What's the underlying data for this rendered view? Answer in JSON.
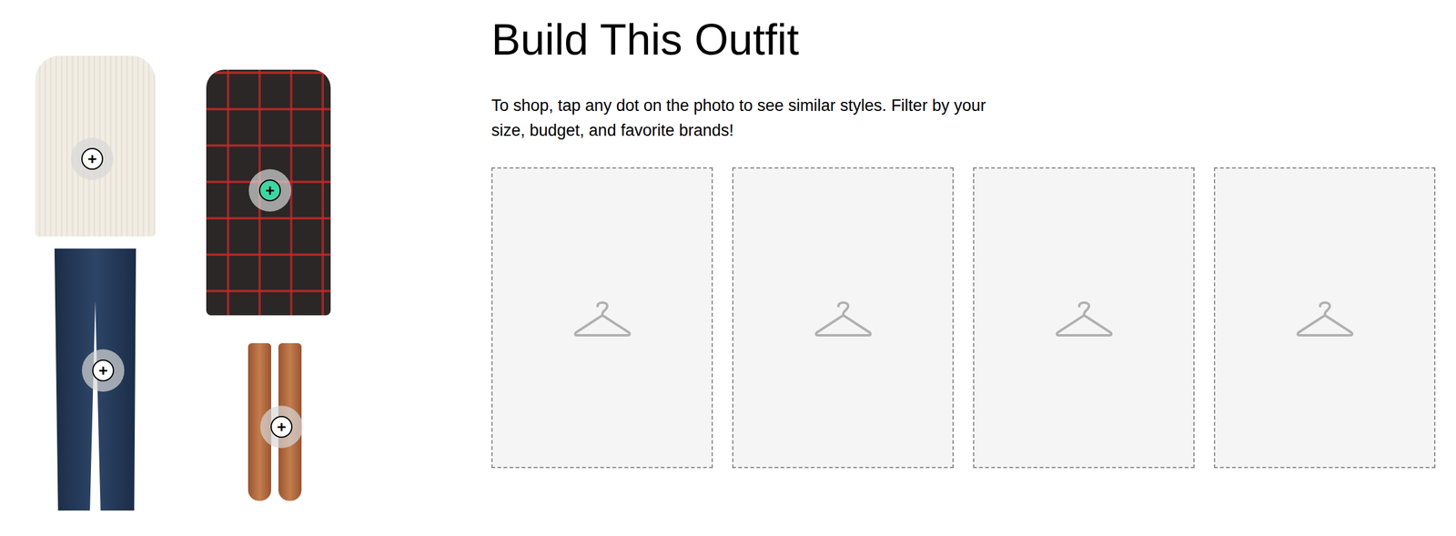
{
  "page": {
    "title": "Build This Outfit",
    "description": "To shop, tap any dot on the photo to see similar styles. Filter by your size, budget, and favorite brands!"
  },
  "outfit": {
    "items": [
      {
        "kind": "sweater",
        "dot": {
          "icon": "+",
          "selected": false
        }
      },
      {
        "kind": "coat",
        "dot": {
          "icon": "+",
          "selected": true
        }
      },
      {
        "kind": "jeans",
        "dot": {
          "icon": "+",
          "selected": false
        }
      },
      {
        "kind": "boots",
        "dot": {
          "icon": "+",
          "selected": false
        }
      }
    ]
  },
  "slots": [
    {
      "empty": true
    },
    {
      "empty": true
    },
    {
      "empty": true
    },
    {
      "empty": true
    }
  ]
}
